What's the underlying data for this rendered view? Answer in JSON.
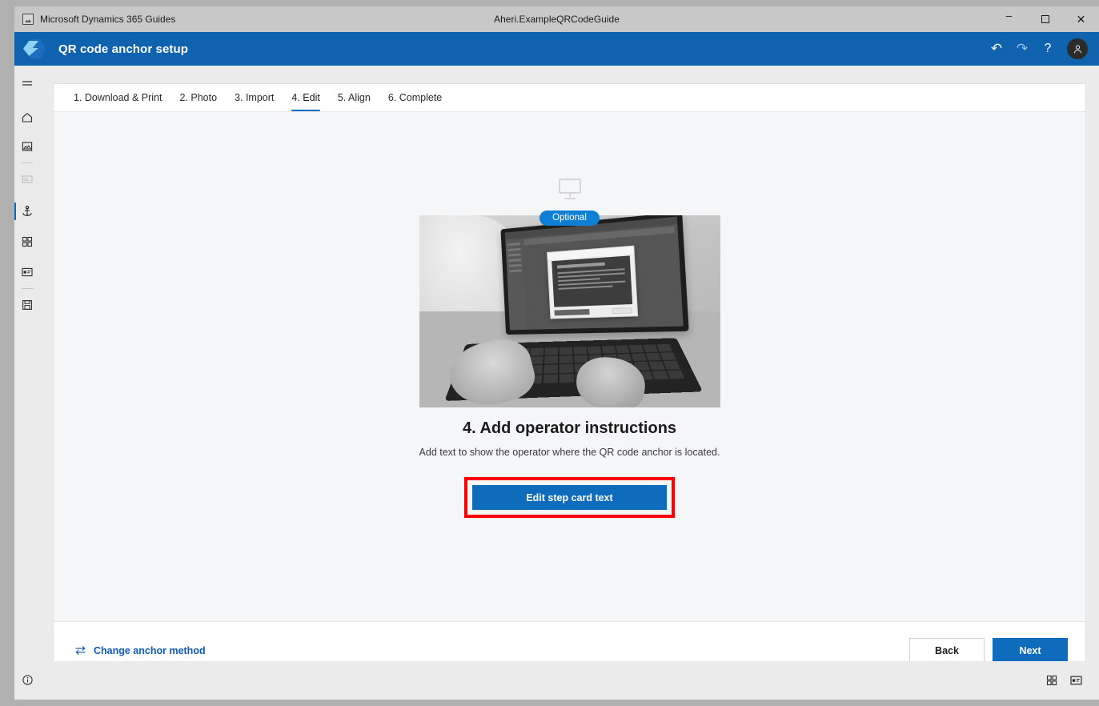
{
  "titlebar": {
    "app_name": "Microsoft Dynamics 365 Guides",
    "document_title": "Aheri.ExampleQRCodeGuide",
    "minimize_label": "–",
    "maximize_label": "",
    "close_label": "✕"
  },
  "header": {
    "title": "QR code anchor setup",
    "undo_label": "↶",
    "redo_label": "↷",
    "help_label": "?",
    "avatar_label": "⚹"
  },
  "sidebar": {
    "items": [
      {
        "name": "menu",
        "label": "Menu"
      },
      {
        "name": "home",
        "label": "Home"
      },
      {
        "name": "media",
        "label": "Media"
      },
      {
        "name": "step-card",
        "label": "Step card"
      },
      {
        "name": "anchor",
        "label": "Anchor"
      },
      {
        "name": "grid",
        "label": "Grid"
      },
      {
        "name": "panel",
        "label": "Panel"
      },
      {
        "name": "save",
        "label": "Save"
      }
    ],
    "info_label": "Info"
  },
  "tabs": [
    {
      "label": "1. Download & Print",
      "active": false
    },
    {
      "label": "2. Photo",
      "active": false
    },
    {
      "label": "3. Import",
      "active": false
    },
    {
      "label": "4. Edit",
      "active": true
    },
    {
      "label": "5. Align",
      "active": false
    },
    {
      "label": "6. Complete",
      "active": false
    }
  ],
  "main": {
    "badge": "Optional",
    "title": "4. Add operator instructions",
    "description": "Add text to show the operator where the QR code anchor is located.",
    "edit_button": "Edit step card text",
    "highlight_color": "#ff0000",
    "accent_color": "#0f6cbd"
  },
  "footer": {
    "change_anchor_label": "Change anchor method",
    "back_label": "Back",
    "next_label": "Next"
  },
  "statusbar": {
    "grid_view_label": "Grid view",
    "card_view_label": "Card view"
  }
}
